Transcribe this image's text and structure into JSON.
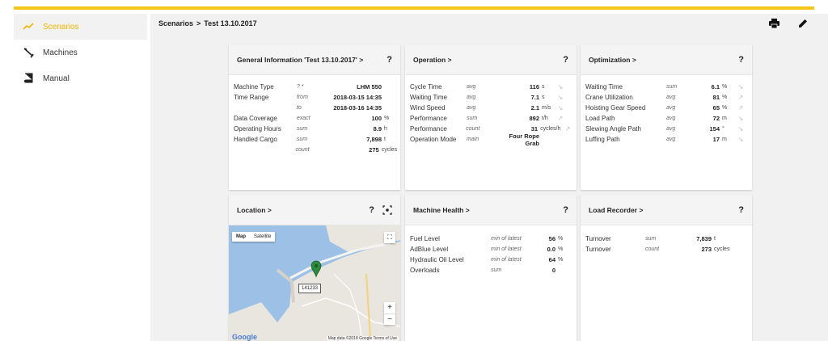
{
  "sidebar": {
    "items": [
      {
        "label": "Scenarios",
        "icon": "trending-up-icon"
      },
      {
        "label": "Machines",
        "icon": "crane-icon"
      },
      {
        "label": "Manual",
        "icon": "book-icon"
      }
    ]
  },
  "breadcrumb": {
    "root": "Scenarios",
    "separator": ">",
    "current": "Test 13.10.2017"
  },
  "colors": {
    "accent": "#f5c518",
    "active_text": "#f0b400"
  },
  "cards": {
    "general": {
      "title": "General Information 'Test 13.10.2017'",
      "chevron": ">",
      "help": "?",
      "rows": [
        {
          "label": "Machine Type",
          "agg": "? *",
          "value": "LHM 550",
          "unit": ""
        },
        {
          "label": "Time Range",
          "agg": "from",
          "value": "2018-03-15 14:35",
          "unit": ""
        },
        {
          "label": "",
          "agg": "to",
          "value": "2018-03-16 14:35",
          "unit": ""
        },
        {
          "label": "Data Coverage",
          "agg": "exact",
          "value": "100",
          "unit": "%"
        },
        {
          "label": "Operating Hours",
          "agg": "sum",
          "value": "8.9",
          "unit": "h"
        },
        {
          "label": "Handled Cargo",
          "agg": "sum",
          "value": "7,898",
          "unit": "t"
        },
        {
          "label": "",
          "agg": "count",
          "value": "275",
          "unit": "cycles"
        }
      ]
    },
    "operation": {
      "title": "Operation",
      "chevron": ">",
      "help": "?",
      "rows": [
        {
          "label": "Cycle Time",
          "agg": "avg",
          "value": "116",
          "unit": "s",
          "arrow": "↘"
        },
        {
          "label": "Waiting Time",
          "agg": "avg",
          "value": "7.1",
          "unit": "s",
          "arrow": "↘"
        },
        {
          "label": "Wind Speed",
          "agg": "avg",
          "value": "2.1",
          "unit": "m/s",
          "arrow": "↘"
        },
        {
          "label": "Performance",
          "agg": "sum",
          "value": "892",
          "unit": "t/h",
          "arrow": "↗"
        },
        {
          "label": "Performance",
          "agg": "count",
          "value": "31",
          "unit": "cycles/h",
          "arrow": "↗"
        },
        {
          "label": "Operation Mode",
          "agg": "main",
          "value": "Four Rope Grab",
          "unit": "",
          "arrow": ""
        }
      ]
    },
    "optimization": {
      "title": "Optimization",
      "chevron": ">",
      "help": "?",
      "rows": [
        {
          "label": "Waiting Time",
          "agg": "sum",
          "value": "6.1",
          "unit": "%",
          "arrow": "↘"
        },
        {
          "label": "Crane Utilization",
          "agg": "avg",
          "value": "81",
          "unit": "%",
          "arrow": "↗"
        },
        {
          "label": "Hoisting Gear Speed",
          "agg": "avg",
          "value": "65",
          "unit": "%",
          "arrow": "↗"
        },
        {
          "label": "Load Path",
          "agg": "avg",
          "value": "72",
          "unit": "m",
          "arrow": "↘"
        },
        {
          "label": "Slewing Angle Path",
          "agg": "avg",
          "value": "154",
          "unit": "°",
          "arrow": "↘"
        },
        {
          "label": "Luffing Path",
          "agg": "avg",
          "value": "17",
          "unit": "m",
          "arrow": "↘"
        }
      ]
    },
    "location": {
      "title": "Location",
      "chevron": ">",
      "help": "?",
      "map_tab": "Map",
      "satellite_tab": "Satellite",
      "marker": "141233",
      "zoom_in": "+",
      "zoom_out": "−",
      "google": "Google",
      "footer": "Map data ©2018 Google   Terms of Use"
    },
    "health": {
      "title": "Machine Health",
      "chevron": ">",
      "help": "?",
      "rows": [
        {
          "label": "Fuel Level",
          "agg": "min of latest",
          "value": "56",
          "unit": "%"
        },
        {
          "label": "AdBlue Level",
          "agg": "min of latest",
          "value": "0.0",
          "unit": "%"
        },
        {
          "label": "Hydraulic Oil Level",
          "agg": "min of latest",
          "value": "64",
          "unit": "%"
        },
        {
          "label": "Overloads",
          "agg": "sum",
          "value": "0",
          "unit": ""
        }
      ]
    },
    "recorder": {
      "title": "Load Recorder",
      "chevron": ">",
      "help": "?",
      "rows": [
        {
          "label": "Turnover",
          "agg": "sum",
          "value": "7,839",
          "unit": "t"
        },
        {
          "label": "Turnover",
          "agg": "count",
          "value": "273",
          "unit": "cycles"
        }
      ]
    }
  }
}
